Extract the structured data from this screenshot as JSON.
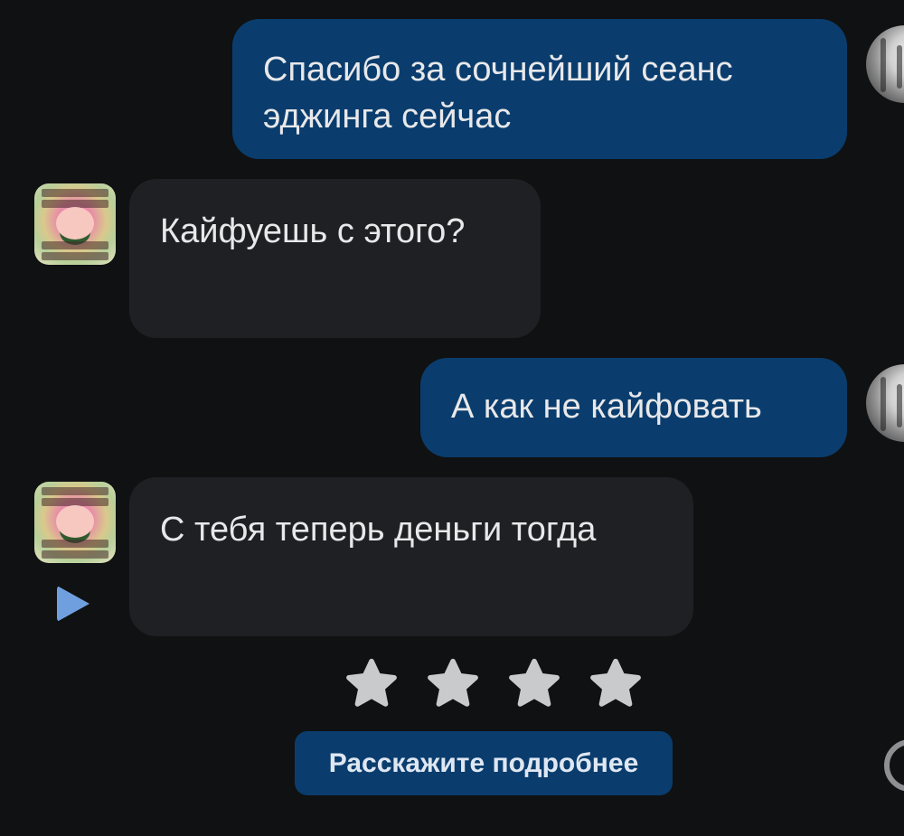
{
  "messages": [
    {
      "direction": "out",
      "text": "Спасибо за сочнейший сеанс эджинга сейчас"
    },
    {
      "direction": "in",
      "text": "Кайфуешь с этого?"
    },
    {
      "direction": "out",
      "text": "А как не кайфовать"
    },
    {
      "direction": "in",
      "text": "С тебя теперь деньги тогда"
    }
  ],
  "rating": {
    "total_stars": 4,
    "selected_stars": 0
  },
  "feedback_button": {
    "label": "Расскажите подробнее"
  },
  "icons": {
    "play": "play-icon",
    "star": "star-icon"
  },
  "colors": {
    "background": "#101112",
    "outgoing_bubble": "#0a3d6d",
    "incoming_bubble": "#1f2023",
    "text": "#e8e8ea",
    "play_accent": "#6f9fde",
    "star": "#c9cacc"
  }
}
